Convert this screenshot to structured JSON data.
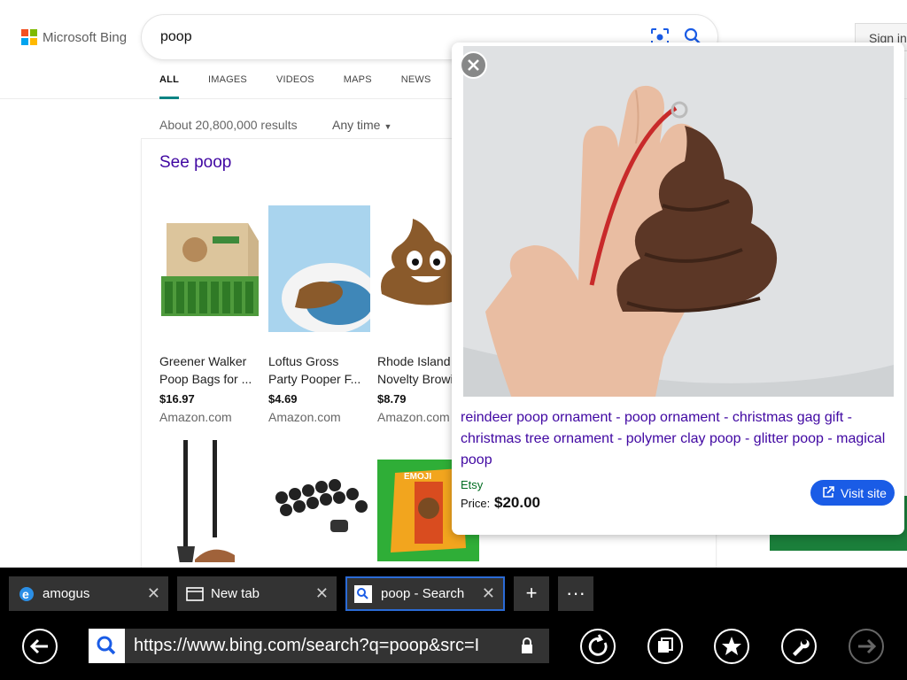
{
  "header": {
    "logo_text": "Microsoft Bing",
    "query": "poop",
    "signin_label": "Sign in",
    "tabs": [
      "ALL",
      "IMAGES",
      "VIDEOS",
      "MAPS",
      "NEWS"
    ],
    "active_tab": "ALL"
  },
  "results": {
    "count_text": "About 20,800,000 results",
    "time_filter": "Any time"
  },
  "shopping": {
    "title": "See poop",
    "products": [
      {
        "name": "Greener Walker",
        "name2": "Poop Bags for ...",
        "price": "$16.97",
        "seller": "Amazon.com"
      },
      {
        "name": "Loftus Gross",
        "name2": "Party Pooper F...",
        "price": "$4.69",
        "seller": "Amazon.com"
      },
      {
        "name": "Rhode Island",
        "name2": "Novelty Browi",
        "price": "$8.79",
        "seller": "Amazon.com"
      }
    ]
  },
  "popup": {
    "title": "reindeer poop ornament - poop ornament - christmas gag gift - christmas tree ornament - polymer clay poop - glitter poop - magical poop",
    "seller": "Etsy",
    "price_label": "Price:",
    "price": "$20.00",
    "visit_label": "Visit site"
  },
  "browser": {
    "tabs": [
      {
        "label": "amogus",
        "icon": "ie-icon",
        "active": false
      },
      {
        "label": "New tab",
        "icon": "new-tab-icon",
        "active": false
      },
      {
        "label": "poop - Search",
        "icon": "bing-search-icon",
        "active": true
      }
    ],
    "new_tab_label": "+",
    "more_label": "···",
    "url": "https://www.bing.com/search?q=poop&src=I"
  },
  "colors": {
    "link_purple": "#4007a2",
    "accent_teal": "#0c8484",
    "visit_blue": "#1a5ce6",
    "tab_active_border": "#2b6bd6"
  }
}
